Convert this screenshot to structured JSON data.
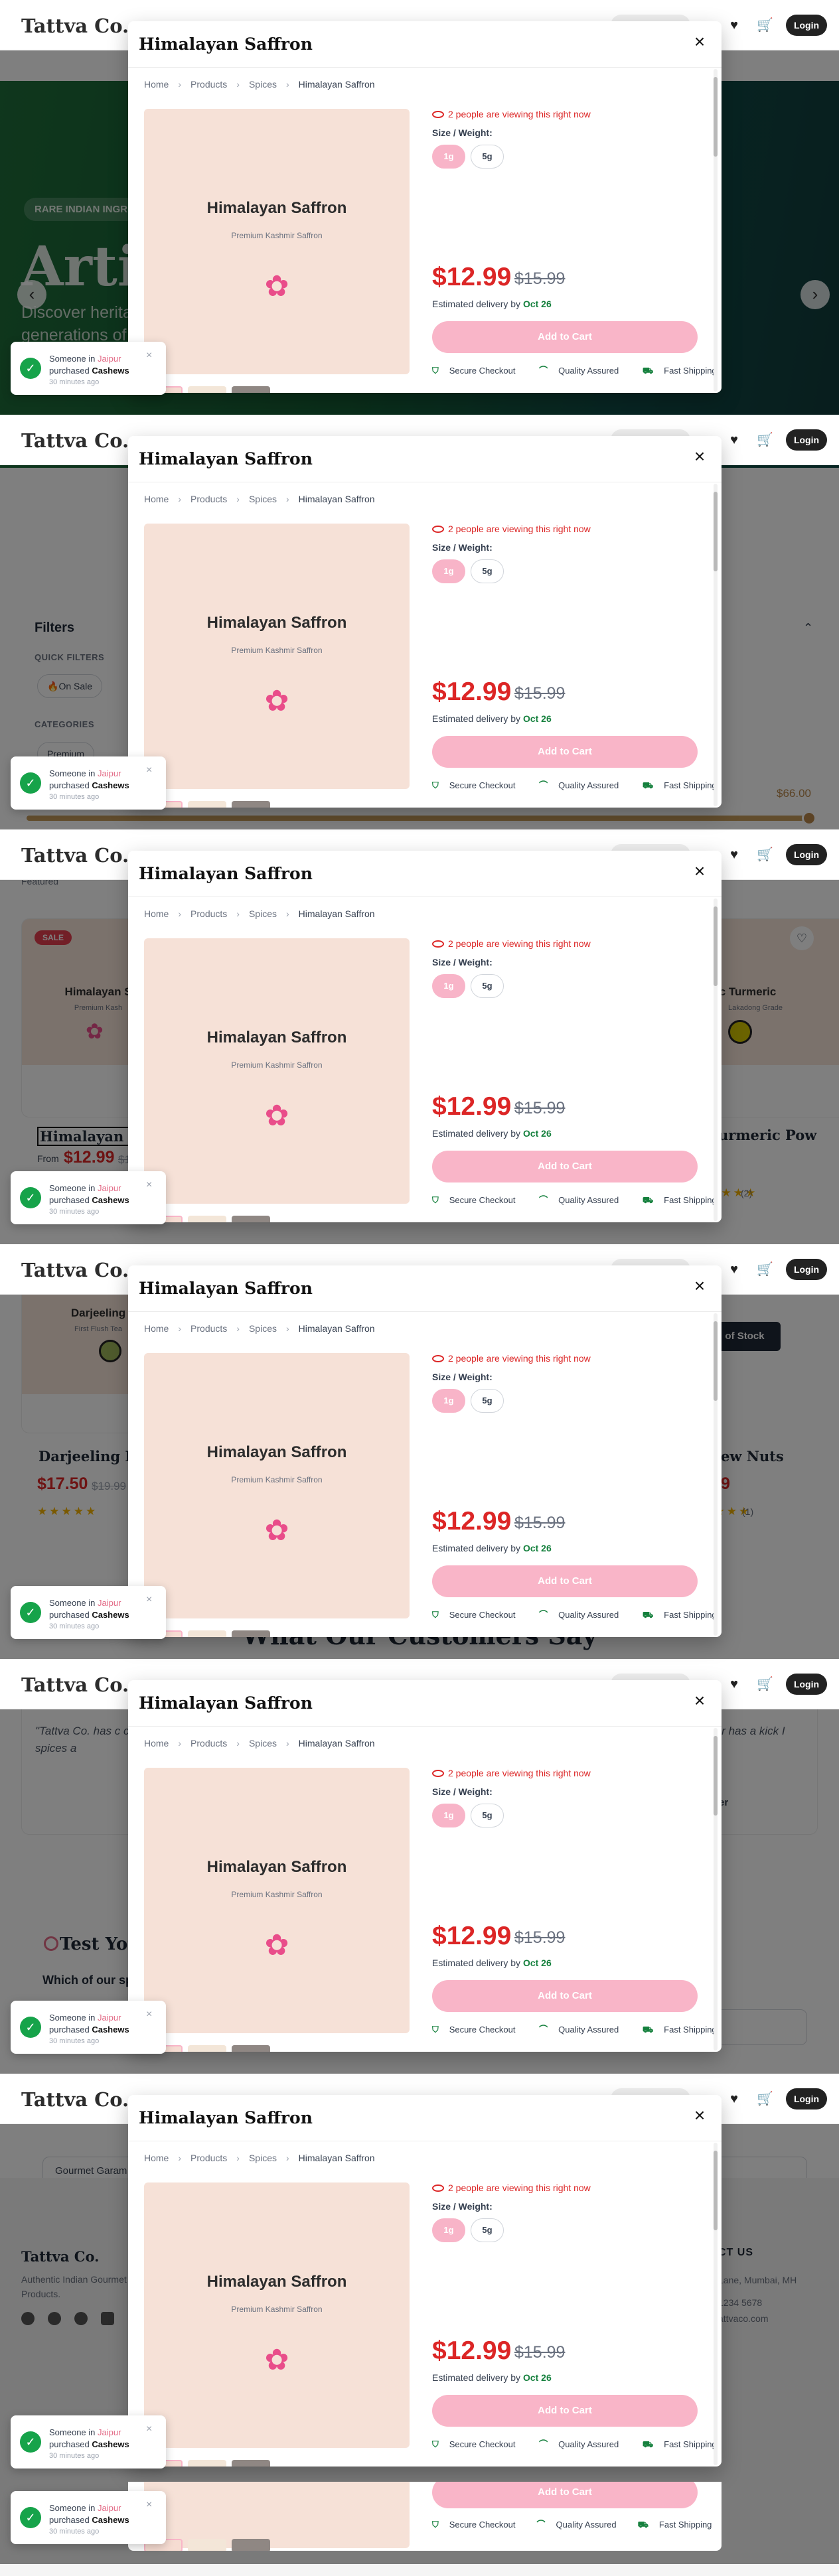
{
  "header": {
    "logo": "Tattva Co.",
    "login_label": "Login"
  },
  "hero": {
    "tag": "RARE INDIAN INGR",
    "title": "Artis",
    "subtitle_line1": "Discover herita",
    "subtitle_line2": "generations of"
  },
  "filters": {
    "title": "Filters",
    "quick_label": "QUICK FILTERS",
    "quick_chip": "On Sale",
    "categories_label": "CATEGORIES",
    "category_chip": "Premium",
    "price_max": "$66.00"
  },
  "products": {
    "sort_label": "Featured",
    "sale_badge": "SALE",
    "card1": {
      "image_name": "Himalayan S",
      "image_sub": "Premium Kash",
      "title": "Himalayan Saf",
      "price": "$12.99",
      "old_price": "$1",
      "price_prefix": "From "
    },
    "card2": {
      "image_name": "ic Turmeric",
      "image_sub": "Lakadong Grade",
      "title": "urmeric Pow",
      "reviews": "(2)"
    },
    "card3": {
      "image_name": "Darjeeling",
      "image_sub": "First Flush Tea",
      "title": "Darjeeling First",
      "price": "$17.50",
      "old_price": "$19.99"
    },
    "card4": {
      "title": "ew Nuts",
      "price_frag": "9",
      "reviews": "(1)"
    },
    "out_of_stock": "of Stock",
    "stars": "★★★★★"
  },
  "testimonials": {
    "heading": "What Our Customers Say",
    "quote_left": "\"Tattva Co. has c cooking. The fr spices a",
    "quote_right": "ible customer oper has a kick I here else.\"",
    "author_left": "- ",
    "author_right": "er"
  },
  "quiz": {
    "title": "Test You",
    "question": "Which of our sp",
    "answer_value": "Gourmet Garam"
  },
  "footer": {
    "logo": "Tattva Co.",
    "description": "Authentic Indian Gourmet Products.",
    "contact_heading": "CT US",
    "contact_addr": "Lane, Mumbai, MH",
    "contact_phone": "1234 5678",
    "contact_email": "attvaco.com"
  },
  "modal": {
    "title": "Himalayan Saffron",
    "close_glyph": "×",
    "breadcrumbs": [
      "Home",
      "Products",
      "Spices",
      "Himalayan Saffron"
    ],
    "breadcrumb_sep": "›",
    "image_name": "Himalayan Saffron",
    "image_sub": "Premium Kashmir Saffron",
    "viewers_text": "2 people are viewing this right now",
    "size_label": "Size / Weight:",
    "sizes": [
      "1g",
      "5g"
    ],
    "price": "$12.99",
    "old_price": "$15.99",
    "delivery_prefix": "Estimated delivery by ",
    "delivery_date": "Oct 26",
    "add_to_cart": "Add to Cart",
    "badges": [
      "Secure Checkout",
      "Quality Assured",
      "Fast Shipping"
    ]
  },
  "toast": {
    "prefix": "Someone in ",
    "city": "Jaipur",
    "action": "purchased ",
    "product": "Cashews",
    "time": "30 minutes ago",
    "close_glyph": "×"
  },
  "colors": {
    "accent_pink": "#f9b5c8",
    "price_red": "#dc2626",
    "success_green": "#16a34a",
    "hero_green": "#1f6e3a"
  }
}
